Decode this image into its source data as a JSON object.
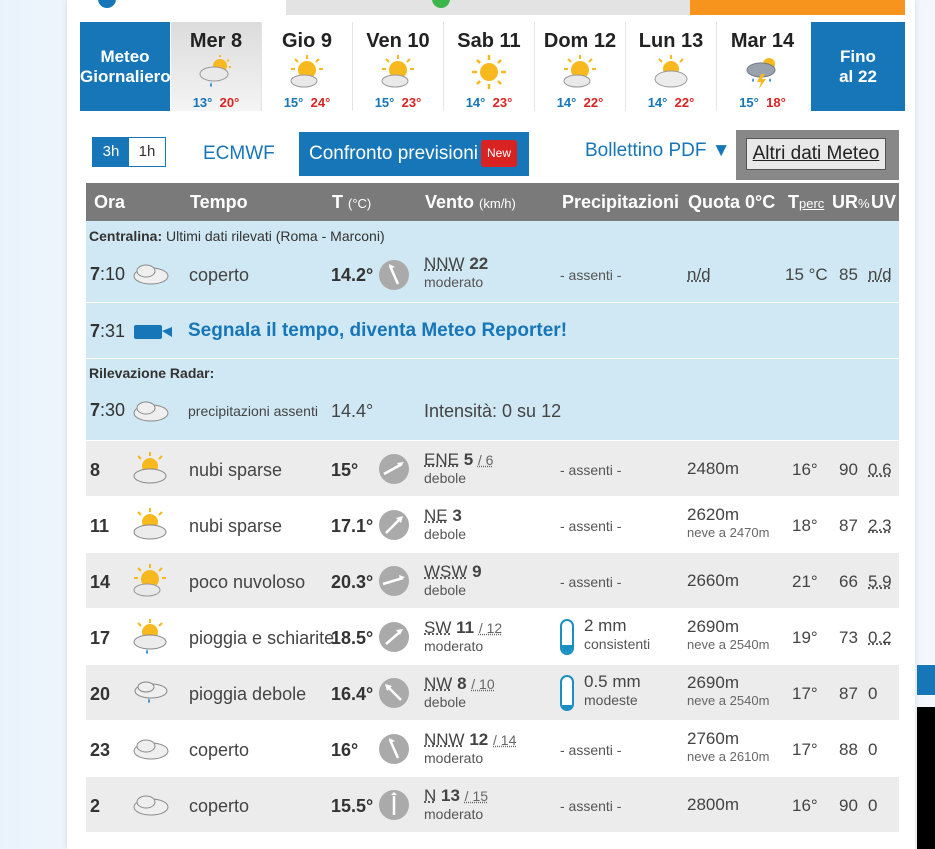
{
  "days": {
    "left_tab": [
      "Meteo",
      "Giornaliero"
    ],
    "right_tab": [
      "Fino",
      "al 22"
    ],
    "items": [
      {
        "name": "Mer 8",
        "min": "13°",
        "max": "20°",
        "icon": "rain-cloud-sun-icon",
        "active": true
      },
      {
        "name": "Gio 9",
        "min": "15°",
        "max": "24°",
        "icon": "partly-cloudy-icon"
      },
      {
        "name": "Ven 10",
        "min": "15°",
        "max": "23°",
        "icon": "partly-cloudy-icon"
      },
      {
        "name": "Sab 11",
        "min": "14°",
        "max": "23°",
        "icon": "sun-icon"
      },
      {
        "name": "Dom 12",
        "min": "14°",
        "max": "22°",
        "icon": "partly-cloudy-icon"
      },
      {
        "name": "Lun 13",
        "min": "14°",
        "max": "22°",
        "icon": "cloudy-sun-icon"
      },
      {
        "name": "Mar 14",
        "min": "15°",
        "max": "18°",
        "icon": "thunderstorm-icon"
      }
    ]
  },
  "toolbar": {
    "seg_3h": "3h",
    "seg_1h": "1h",
    "model": "ECMWF",
    "confronto": "Confronto previsioni",
    "new_badge": "New",
    "bollettino": "Bollettino PDF ▼",
    "altri": "Altri dati Meteo"
  },
  "header": {
    "ora": "Ora",
    "tempo": "Tempo",
    "t": "T",
    "t_unit": "(°C)",
    "vento": "Vento",
    "vento_unit": "(km/h)",
    "prec": "Precipitazioni",
    "quota": "Quota 0°C",
    "tperc_t": "T",
    "tperc_sub": "perc",
    "ur": "UR",
    "ur_unit": "%",
    "uv": "UV"
  },
  "centralina": {
    "label": "Centralina:",
    "desc": "Ultimi dati rilevati (Roma - Marconi)",
    "hour": "7",
    "min": ":10",
    "tempo": "coperto",
    "temp": "14.2°",
    "wdir": "NNW",
    "wspeed": "22",
    "wlabel": "moderato",
    "prec": "- assenti -",
    "quota": "n/d",
    "tperc": "15 °C",
    "ur": "85",
    "uv": "n/d"
  },
  "reporter": {
    "hour": "7",
    "min": ":31",
    "text": "Segnala il tempo, diventa Meteo Reporter!"
  },
  "radar": {
    "label": "Rilevazione Radar:",
    "hour": "7",
    "min": ":30",
    "tempo": "precipitazioni assenti",
    "temp": "14.4°",
    "intensita": "Intensità: 0 su 12"
  },
  "rows": [
    {
      "ora": "8",
      "tempo": "nubi sparse",
      "temp": "15°",
      "wdir": "ENE",
      "wspeed": "5",
      "gust": "/ 6",
      "wlabel": "debole",
      "prec": "- assenti -",
      "quota": "2480m",
      "neve": "",
      "tperc": "16°",
      "ur": "90",
      "uv": "0.6"
    },
    {
      "ora": "11",
      "tempo": "nubi sparse",
      "temp": "17.1°",
      "wdir": "NE",
      "wspeed": "3",
      "gust": "",
      "wlabel": "debole",
      "prec": "- assenti -",
      "quota": "2620m",
      "neve": "neve a 2470m",
      "tperc": "18°",
      "ur": "87",
      "uv": "2.3"
    },
    {
      "ora": "14",
      "tempo": "poco nuvoloso",
      "temp": "20.3°",
      "wdir": "WSW",
      "wspeed": "9",
      "gust": "",
      "wlabel": "debole",
      "prec": "- assenti -",
      "quota": "2660m",
      "neve": "",
      "tperc": "21°",
      "ur": "66",
      "uv": "5.9"
    },
    {
      "ora": "17",
      "tempo": "pioggia e schiarite",
      "temp": "18.5°",
      "wdir": "SW",
      "wspeed": "11",
      "gust": "/ 12",
      "wlabel": "moderato",
      "prec_mm": "2 mm",
      "prec_lbl": "consistenti",
      "quota": "2690m",
      "neve": "neve a 2540m",
      "tperc": "19°",
      "ur": "73",
      "uv": "0.2"
    },
    {
      "ora": "20",
      "tempo": "pioggia debole",
      "temp": "16.4°",
      "wdir": "NW",
      "wspeed": "8",
      "gust": "/ 10",
      "wlabel": "debole",
      "prec_mm": "0.5 mm",
      "prec_lbl": "modeste",
      "quota": "2690m",
      "neve": "neve a 2540m",
      "tperc": "17°",
      "ur": "87",
      "uv": "0"
    },
    {
      "ora": "23",
      "tempo": "coperto",
      "temp": "16°",
      "wdir": "NNW",
      "wspeed": "12",
      "gust": "/ 14",
      "wlabel": "moderato",
      "prec": "- assenti -",
      "quota": "2760m",
      "neve": "neve a 2610m",
      "tperc": "17°",
      "ur": "88",
      "uv": "0"
    },
    {
      "ora": "2",
      "tempo": "coperto",
      "temp": "15.5°",
      "wdir": "N",
      "wspeed": "13",
      "gust": "/ 15",
      "wlabel": "moderato",
      "prec": "- assenti -",
      "quota": "2800m",
      "neve": "",
      "tperc": "16°",
      "ur": "90",
      "uv": "0"
    }
  ],
  "colors": {
    "brand_blue": "#1676b8",
    "orange": "#f7941d",
    "max_red": "#d92323"
  }
}
